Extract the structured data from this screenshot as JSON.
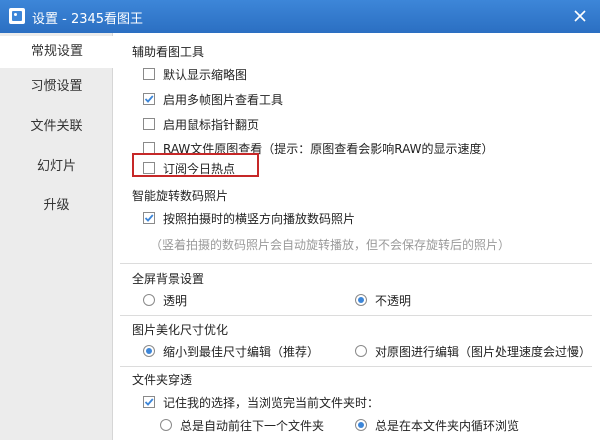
{
  "window": {
    "title": "设置 - 2345看图王"
  },
  "sidebar": {
    "items": [
      {
        "label": "常规设置"
      },
      {
        "label": "习惯设置"
      },
      {
        "label": "文件关联"
      },
      {
        "label": "幻灯片"
      },
      {
        "label": "升级"
      }
    ],
    "active": "常规设置"
  },
  "sections": {
    "viewer_tools": {
      "title": "辅助看图工具",
      "options": [
        {
          "label": "默认显示缩略图",
          "checked": false
        },
        {
          "label": "启用多帧图片查看工具",
          "checked": true
        },
        {
          "label": "启用鼠标指针翻页",
          "checked": false
        },
        {
          "label": "RAW文件原图查看（提示：原图查看会影响RAW的显示速度）",
          "checked": false
        },
        {
          "label": "订阅今日热点",
          "checked": false,
          "highlighted": true
        }
      ]
    },
    "rotate": {
      "title": "智能旋转数码照片",
      "option": {
        "label": "按照拍摄时的横竖方向播放数码照片",
        "checked": true
      },
      "hint": "（竖着拍摄的数码照片会自动旋转播放，但不会保存旋转后的照片）"
    },
    "fullscreen": {
      "title": "全屏背景设置",
      "options": [
        {
          "label": "透明",
          "selected": false
        },
        {
          "label": "不透明",
          "selected": true
        }
      ]
    },
    "resize": {
      "title": "图片美化尺寸优化",
      "options": [
        {
          "label": "缩小到最佳尺寸编辑（推荐）",
          "selected": true
        },
        {
          "label": "对原图进行编辑（图片处理速度会过慢）",
          "selected": false
        }
      ]
    },
    "folder": {
      "title": "文件夹穿透",
      "option": {
        "label": "记住我的选择，当浏览完当前文件夹时：",
        "checked": true
      },
      "suboptions": [
        {
          "label": "总是自动前往下一个文件夹",
          "selected": false
        },
        {
          "label": "总是在本文件夹内循环浏览",
          "selected": true
        }
      ]
    }
  },
  "colors": {
    "accent": "#3d86d8",
    "highlight_border": "#c62828"
  },
  "icons": {
    "app": "image-viewer-icon",
    "close": "close-icon",
    "check": "checkmark-icon"
  }
}
